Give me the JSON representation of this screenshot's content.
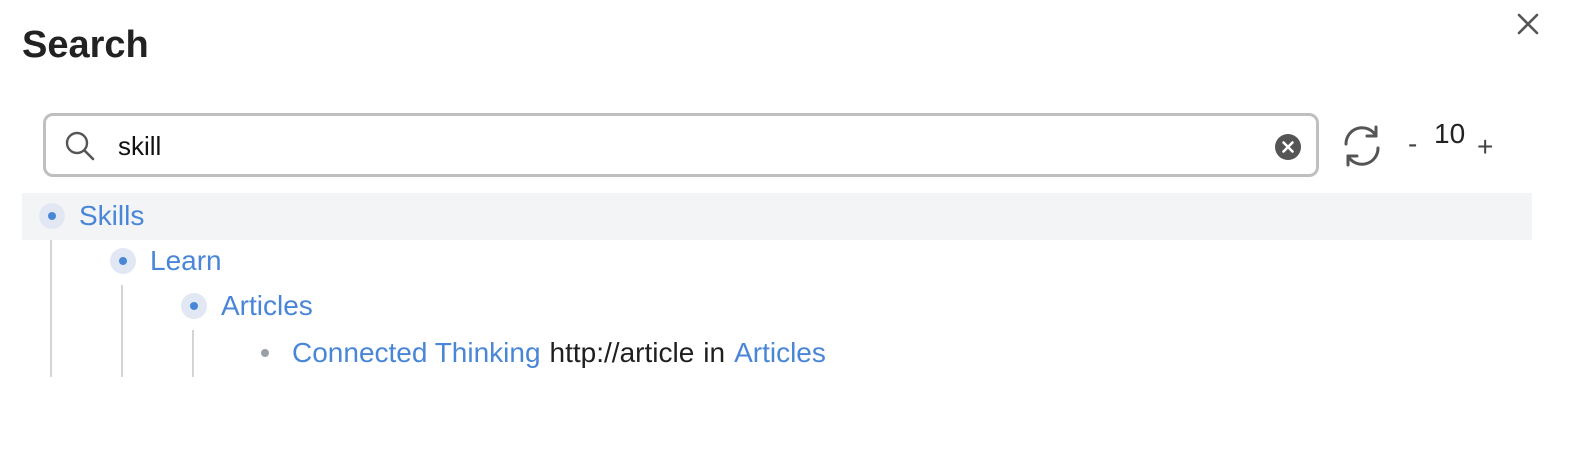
{
  "panel": {
    "title": "Search"
  },
  "search": {
    "value": "skill",
    "placeholder": ""
  },
  "controls": {
    "minus_label": "-",
    "count": "10",
    "plus_label": "+"
  },
  "icons": {
    "close": "close-icon",
    "search": "search-icon",
    "clear": "clear-icon",
    "refresh": "refresh-icon"
  },
  "colors": {
    "link": "#4a86d8",
    "bullet_bg": "#e1e8f3",
    "highlight_row": "#f3f4f6"
  },
  "results": {
    "skills": "Skills",
    "learn": "Learn",
    "articles": "Articles",
    "match": {
      "title": "Connected Thinking",
      "url": "http://article",
      "in_word": "in",
      "parent": "Articles"
    }
  }
}
